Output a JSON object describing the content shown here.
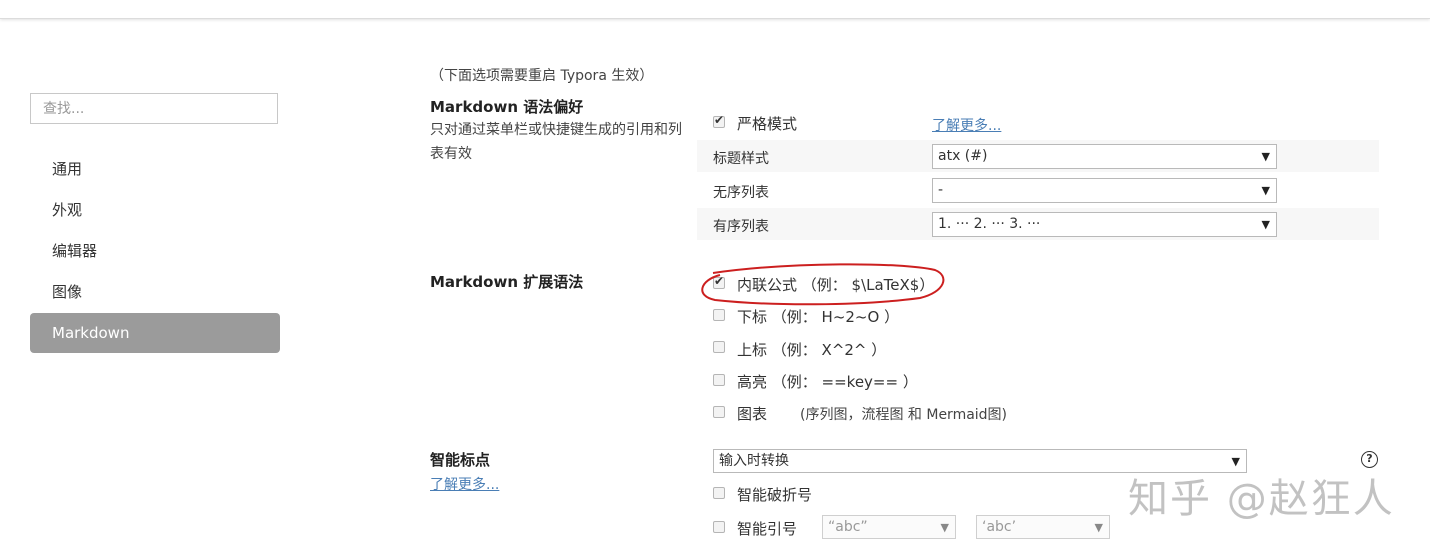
{
  "sidebar": {
    "search_placeholder": "查找...",
    "items": [
      {
        "label": "通用"
      },
      {
        "label": "外观"
      },
      {
        "label": "编辑器"
      },
      {
        "label": "图像"
      },
      {
        "label": "Markdown"
      }
    ],
    "active": "Markdown"
  },
  "main": {
    "restart_note": "（下面选项需要重启 Typora 生效）",
    "syntax_pref": {
      "title": "Markdown 语法偏好",
      "desc": "只对通过菜单栏或快捷键生成的引用和列表有效",
      "strict_mode": {
        "label": "严格模式",
        "checked": true
      },
      "learn_more": "了解更多...",
      "heading_style": {
        "label": "标题样式",
        "value": "atx (#)"
      },
      "unordered_list": {
        "label": "无序列表",
        "value": "-"
      },
      "ordered_list": {
        "label": "有序列表",
        "value": "1. ··· 2. ··· 3. ···"
      }
    },
    "extended_syntax": {
      "title": "Markdown 扩展语法",
      "options": [
        {
          "label": "内联公式 （例： $\\LaTeX$）",
          "checked": true
        },
        {
          "label": "下标 （例： H~2~O ）",
          "checked": false
        },
        {
          "label": "上标 （例： X^2^ ）",
          "checked": false
        },
        {
          "label": "高亮 （例： ==key== ）",
          "checked": false
        },
        {
          "label": "图表",
          "checked": false,
          "note": "(序列图，流程图 和 Mermaid图)"
        }
      ]
    },
    "smart_punct": {
      "title": "智能标点",
      "learn_more": "了解更多...",
      "mode": "输入时转换",
      "smart_dash": {
        "label": "智能破折号",
        "checked": false
      },
      "smart_quotes": {
        "label": "智能引号",
        "checked": false,
        "double_value": "“abc”",
        "single_value": "‘abc’"
      }
    }
  },
  "watermark": "知乎 @赵狂人",
  "colors": {
    "accent_link": "#4a7eb5",
    "active_nav_bg": "#9b9b9b",
    "annotation": "#cc1f1f"
  }
}
